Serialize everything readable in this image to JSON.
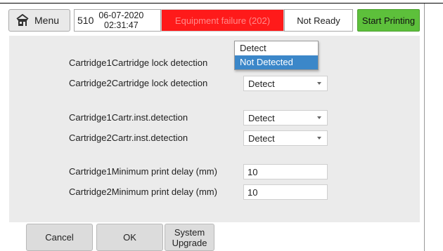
{
  "header": {
    "menu_label": "Menu",
    "menu_icon": "home-icon",
    "code": "510",
    "date": "06-07-2020",
    "time": "02:31:47",
    "error": "Equipment failure (202)",
    "status": "Not Ready",
    "start_label": "Start Printing",
    "colors": {
      "error_bg": "#ff1a1a",
      "start_bg": "#5dc03b"
    }
  },
  "settings": {
    "c1_lock": {
      "label": "Cartridge1Cartridge lock detection"
    },
    "c2_lock": {
      "label": "Cartridge2Cartridge lock detection",
      "value": "Detect"
    },
    "c1_inst": {
      "label": "Cartridge1Cartr.inst.detection",
      "value": "Detect"
    },
    "c2_inst": {
      "label": "Cartridge2Cartr.inst.detection",
      "value": "Detect"
    },
    "c1_delay": {
      "label": "Cartridge1Minimum print delay (mm)",
      "value": "10"
    },
    "c2_delay": {
      "label": "Cartridge2Minimum print delay (mm)",
      "value": "10"
    }
  },
  "dropdown": {
    "options": [
      "Detect",
      "Not Detected"
    ],
    "highlighted": "Not Detected",
    "highlight_color": "#3b87c9"
  },
  "footer": {
    "cancel": "Cancel",
    "ok": "OK",
    "upgrade_line1": "System",
    "upgrade_line2": "Upgrade"
  }
}
